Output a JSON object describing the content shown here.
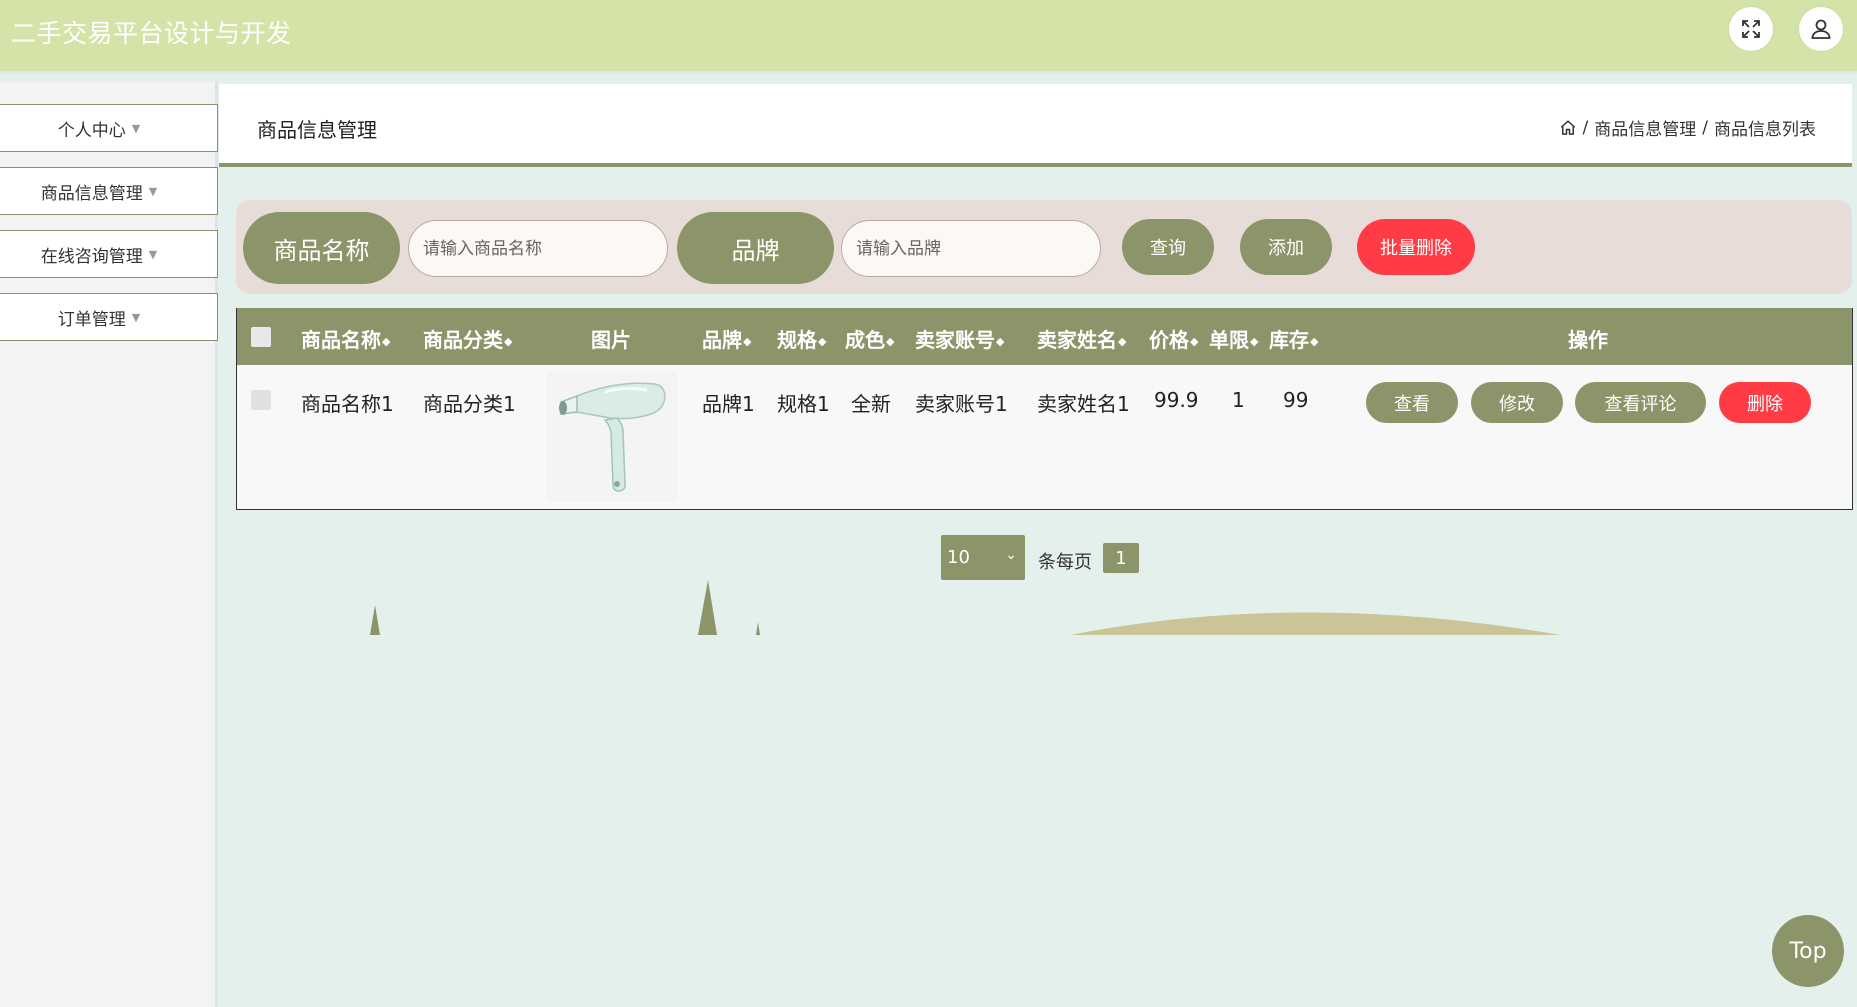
{
  "app": {
    "title": "二手交易平台设计与开发"
  },
  "header_icons": {
    "fullscreen": "fullscreen-icon",
    "user": "user-icon"
  },
  "sidebar": {
    "items": [
      {
        "label": "个人中心"
      },
      {
        "label": "商品信息管理"
      },
      {
        "label": "在线咨询管理"
      },
      {
        "label": "订单管理"
      }
    ]
  },
  "page": {
    "title": "商品信息管理",
    "breadcrumb": [
      "商品信息管理",
      "商品信息列表"
    ],
    "breadcrumb_sep": "/"
  },
  "search": {
    "name_label": "商品名称",
    "name_placeholder": "请输入商品名称",
    "brand_label": "品牌",
    "brand_placeholder": "请输入品牌",
    "query_btn": "查询",
    "add_btn": "添加",
    "batch_delete_btn": "批量删除"
  },
  "table": {
    "columns": [
      "商品名称",
      "商品分类",
      "图片",
      "品牌",
      "规格",
      "成色",
      "卖家账号",
      "卖家姓名",
      "价格",
      "单限",
      "库存",
      "操作"
    ],
    "sort_glyph": "◆",
    "rows": [
      {
        "name": "商品名称1",
        "category": "商品分类1",
        "image": "hair-dryer",
        "brand": "品牌1",
        "spec": "规格1",
        "condition": "全新",
        "seller_account": "卖家账号1",
        "seller_name": "卖家姓名1",
        "price": "99.9",
        "limit": "1",
        "stock": "99",
        "actions": {
          "view": "查看",
          "edit": "修改",
          "comments": "查看评论",
          "delete": "删除"
        }
      }
    ]
  },
  "pagination": {
    "page_size": "10",
    "per_page_label": "条每页",
    "current_page": "1"
  },
  "back_to_top": "Top",
  "colors": {
    "header": "#d4e4a9",
    "primary": "#8b9569",
    "danger": "#ff3b45",
    "background": "#e4f0eb",
    "search_bg": "#e8dcd8"
  }
}
